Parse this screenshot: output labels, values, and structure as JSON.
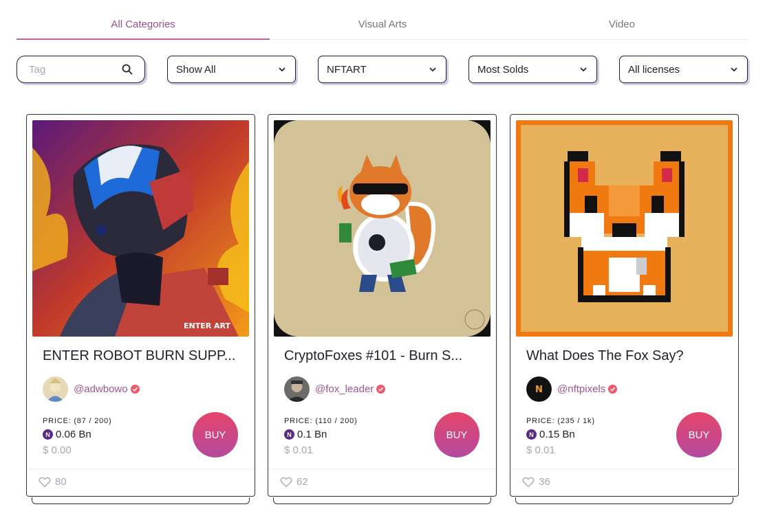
{
  "tabs": [
    {
      "label": "All Categories",
      "active": true
    },
    {
      "label": "Visual Arts",
      "active": false
    },
    {
      "label": "Video",
      "active": false
    }
  ],
  "filters": {
    "search_placeholder": "Tag",
    "type": "Show All",
    "collection": "NFTART",
    "sort": "Most Solds",
    "license": "All licenses"
  },
  "cards": [
    {
      "title": "ENTER ROBOT BURN SUPP...",
      "owner": "@adwbowo",
      "price_label": "PRICE: (87 / 200)",
      "price": "0.06 Bn",
      "usd": "$ 0.00",
      "buy_label": "BUY",
      "likes": "80",
      "art_text": "ENTER ART"
    },
    {
      "title": "CryptoFoxes #101 - Burn S...",
      "owner": "@fox_leader",
      "price_label": "PRICE: (110 / 200)",
      "price": "0.1 Bn",
      "usd": "$ 0.01",
      "buy_label": "BUY",
      "likes": "62"
    },
    {
      "title": "What Does The Fox Say?",
      "owner": "@nftpixels",
      "price_label": "PRICE: (235 / 1k)",
      "price": "0.15 Bn",
      "usd": "$ 0.01",
      "buy_label": "BUY",
      "likes": "36",
      "avatar_letter": "N"
    }
  ],
  "coin_symbol": "N",
  "colors": {
    "accent": "#b7609b",
    "buy_gradient_top": "#e6456a",
    "buy_gradient_bottom": "#b24a9e",
    "verified": "#ef5a6c",
    "coin": "#5b2a86"
  }
}
